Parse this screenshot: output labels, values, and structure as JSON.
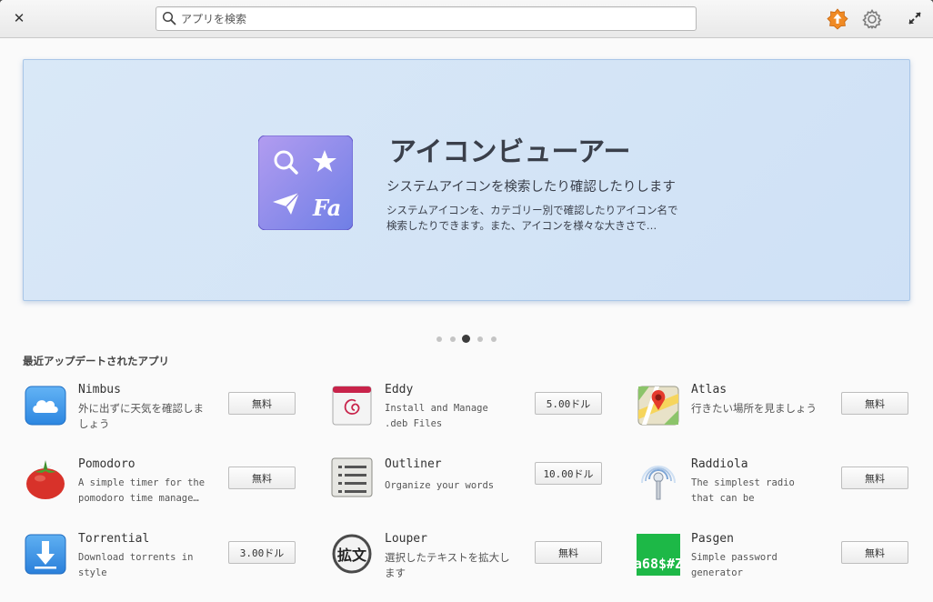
{
  "header": {
    "search_placeholder": "アプリを検索",
    "icons": [
      "close-icon",
      "search-icon",
      "updates-icon",
      "gear-icon",
      "maximize-icon"
    ]
  },
  "banner": {
    "title": "アイコンビューアー",
    "summary": "システムアイコンを検索したり確認したりします",
    "description": "システムアイコンを、カテゴリー別で確認したりアイコン名で検索したりできます。また、アイコンを様々な大きさで…",
    "page_count": 5,
    "active_page": 3
  },
  "section": {
    "title": "最近アップデートされたアプリ"
  },
  "apps": [
    {
      "name": "Nimbus",
      "summary": "外に出ずに天気を確認しましょう",
      "price": "無料"
    },
    {
      "name": "Eddy",
      "summary": "Install and Manage .deb Files",
      "price": "5.00ドル"
    },
    {
      "name": "Atlas",
      "summary": "行きたい場所を見ましょう",
      "price": "無料"
    },
    {
      "name": "Pomodoro",
      "summary": "A simple timer for the pomodoro time manage…",
      "price": "無料"
    },
    {
      "name": "Outliner",
      "summary": "Organize your words",
      "price": "10.00ドル"
    },
    {
      "name": "Raddiola",
      "summary": "The simplest radio that can be",
      "price": "無料"
    },
    {
      "name": "Torrential",
      "summary": "Download torrents in style",
      "price": "3.00ドル"
    },
    {
      "name": "Louper",
      "summary": "選択したテキストを拡大します",
      "price": "無料"
    },
    {
      "name": "Pasgen",
      "summary": "Simple password generator",
      "price": "無料"
    }
  ],
  "icon_texts": {
    "louper": "拡文",
    "pasgen": "a68$#Z",
    "fa": "Fa"
  }
}
